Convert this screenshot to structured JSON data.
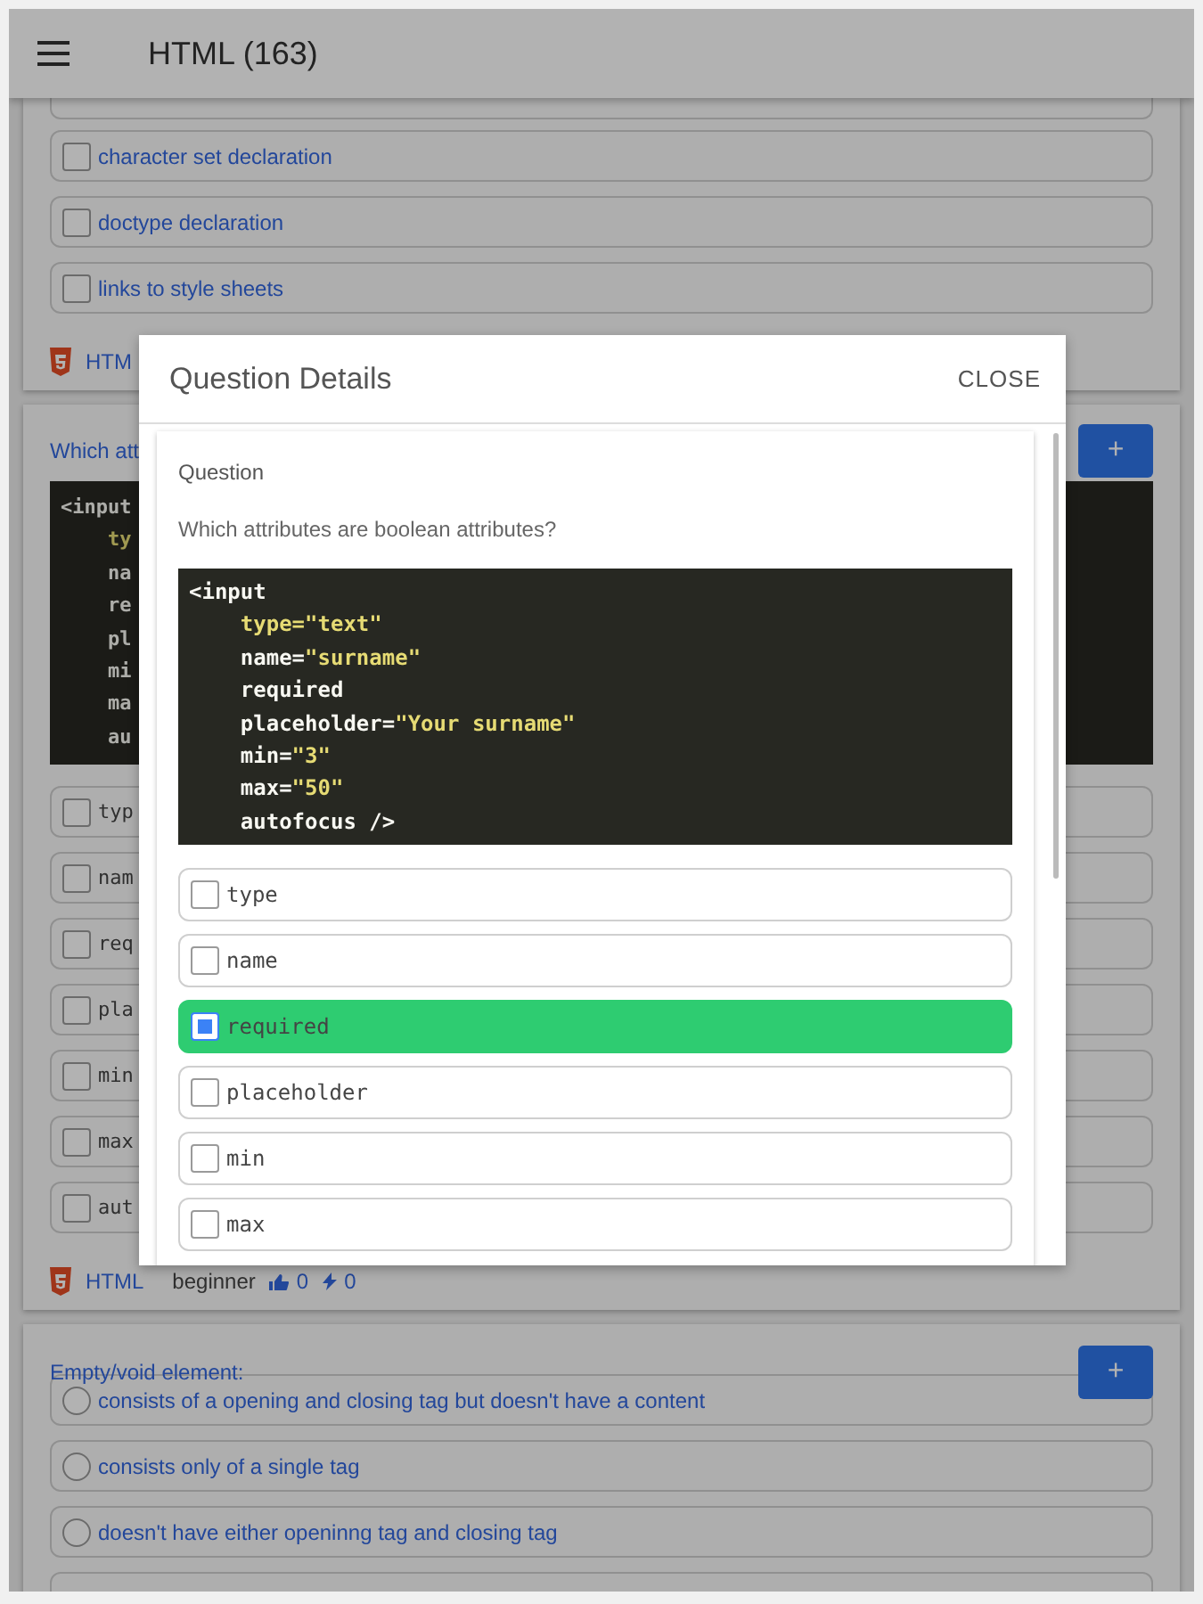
{
  "app_bar": {
    "title": "HTML (163)"
  },
  "cards": [
    {
      "kind": "checkbox",
      "options": [
        {
          "text": "character set declaration",
          "checked": false
        },
        {
          "text": "doctype declaration",
          "checked": false
        },
        {
          "text": "links to style sheets",
          "checked": false
        }
      ],
      "footer": {
        "category": "HTM"
      }
    },
    {
      "question": "Which att",
      "add_button": "+",
      "code_lines": [
        [
          {
            "text": "<input",
            "kind": "plain"
          }
        ],
        [
          {
            "text": "    ty",
            "kind": "string"
          }
        ],
        [
          {
            "text": "    na",
            "kind": "plain"
          }
        ],
        [
          {
            "text": "    re",
            "kind": "plain"
          }
        ],
        [
          {
            "text": "    pl",
            "kind": "plain"
          }
        ],
        [
          {
            "text": "    mi",
            "kind": "plain"
          }
        ],
        [
          {
            "text": "    ma",
            "kind": "plain"
          }
        ],
        [
          {
            "text": "    au",
            "kind": "plain"
          }
        ]
      ],
      "kind": "code-checkbox",
      "options": [
        {
          "text": "typ",
          "checked": false
        },
        {
          "text": "nam",
          "checked": false
        },
        {
          "text": "req",
          "checked": false
        },
        {
          "text": "pla",
          "checked": false
        },
        {
          "text": "min",
          "checked": false
        },
        {
          "text": "max",
          "checked": false
        },
        {
          "text": "aut",
          "checked": false
        }
      ],
      "footer": {
        "category": "HTML",
        "level": "beginner",
        "likes": "0",
        "boosts": "0"
      }
    },
    {
      "question": "Empty/void element:",
      "add_button": "+",
      "kind": "radio",
      "options": [
        {
          "text": "consists of a opening and closing tag but doesn't have a content",
          "checked": false
        },
        {
          "text": "consists only of a single tag",
          "checked": false
        },
        {
          "text": "doesn't have either openinng tag and closing tag",
          "checked": false
        }
      ]
    }
  ],
  "dialog": {
    "title": "Question Details",
    "close": "CLOSE",
    "section_label": "Question",
    "question": "Which attributes are boolean attributes?",
    "code_lines": [
      [
        {
          "text": "<input",
          "kind": "plain"
        }
      ],
      [
        {
          "text": "    type=\"text\"",
          "kind": "string"
        }
      ],
      [
        {
          "text": "    name=",
          "kind": "plain"
        },
        {
          "text": "\"surname\"",
          "kind": "string"
        }
      ],
      [
        {
          "text": "    required",
          "kind": "plain"
        }
      ],
      [
        {
          "text": "    placeholder=",
          "kind": "plain"
        },
        {
          "text": "\"Your surname\"",
          "kind": "string"
        }
      ],
      [
        {
          "text": "    min=",
          "kind": "plain"
        },
        {
          "text": "\"3\"",
          "kind": "string"
        }
      ],
      [
        {
          "text": "    max=",
          "kind": "plain"
        },
        {
          "text": "\"50\"",
          "kind": "string"
        }
      ],
      [
        {
          "text": "    autofocus />",
          "kind": "plain"
        }
      ]
    ],
    "options": [
      {
        "text": "type",
        "checked": false,
        "correct": false
      },
      {
        "text": "name",
        "checked": false,
        "correct": false
      },
      {
        "text": "required",
        "checked": true,
        "correct": true
      },
      {
        "text": "placeholder",
        "checked": false,
        "correct": false
      },
      {
        "text": "min",
        "checked": false,
        "correct": false
      },
      {
        "text": "max",
        "checked": false,
        "correct": false
      }
    ]
  }
}
